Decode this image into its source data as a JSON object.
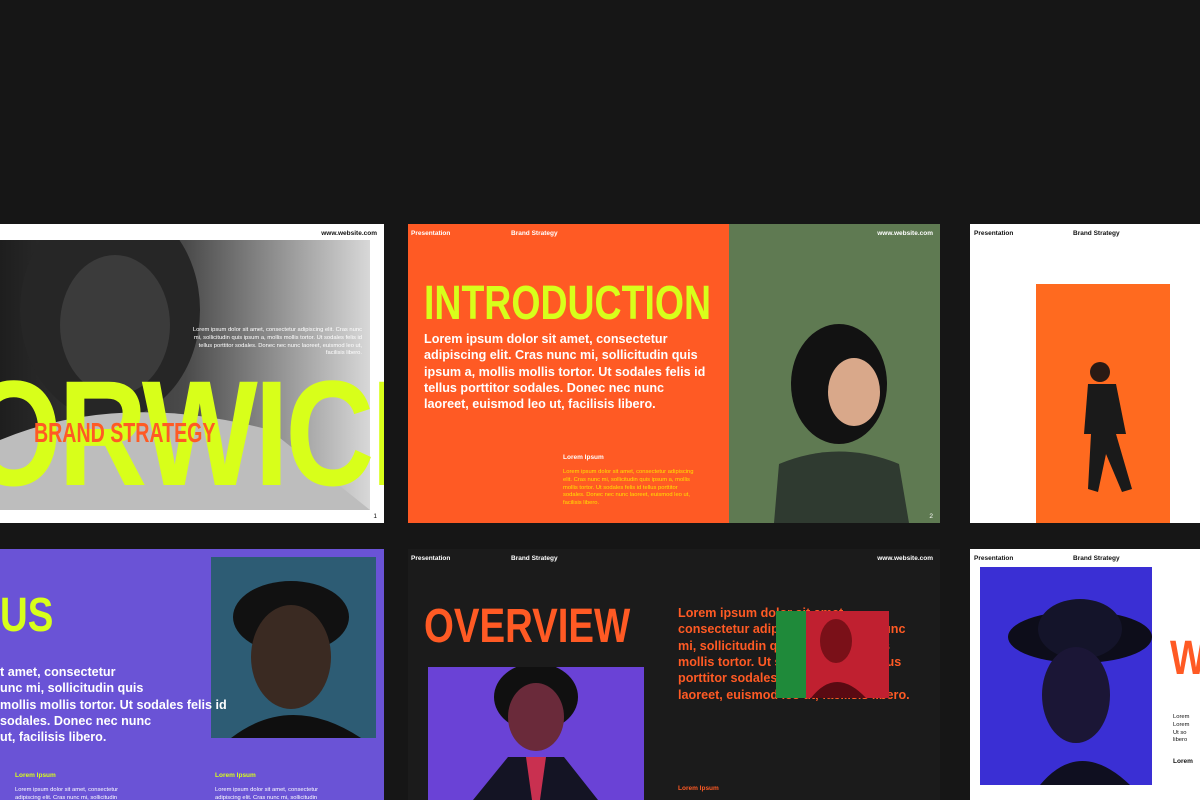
{
  "common": {
    "website": "www.website.com",
    "presentation": "Presentation",
    "brand_strategy": "Brand Strategy",
    "lorem_ipsum": "Lorem Ipsum",
    "small_text": "Lorem ipsum dolor sit amet, consectetur adipiscing elit. Cras nunc mi, sollicitudin quis ipsum a, mollis mollis tortor. Ut sodales felis id tellus porttitor sodales. Donec nec nunc laoreet, euismod leo ut, facilisis libero.",
    "body_text": "Lorem ipsum dolor sit amet, consectetur adipiscing elit. Cras nunc mi, sollicitudin quis ipsum a, mollis mollis tortor. Ut sodales felis id tellus porttitor sodales. Donec nec nunc laoreet, euismod leo ut, facilisis libero."
  },
  "slide1": {
    "big_title": "ORWICH",
    "subtitle": "BRAND STRATEGY",
    "page": "1",
    "small_text": "Lorem ipsum dolor sit amet, consectetur adipiscing elit. Cras nunc mi, sollicitudin quis ipsum a, mollis mollis tortor. Ut sodales felis id tellus porttitor sodales. Donec nec nunc laoreet, euismod leo ut, facilisis libero."
  },
  "slide2": {
    "title": "INTRODUCTION",
    "page": "2"
  },
  "slide4": {
    "title_partial": "US",
    "body_partial": "t amet, consectetur\nunc mi, sollicitudin quis\nmollis mollis tortor. Ut sodales felis id\nsodales. Donec nec nunc\nut, facilisis libero.",
    "label_a": "Lorem Ipsum",
    "label_b": "Lorem Ipsum",
    "small_a": "Lorem ipsum dolor sit amet, consectetur adipiscing elit. Cras nunc mi, sollicitudin",
    "small_b": "Lorem ipsum dolor sit amet, consectetur adipiscing elit. Cras nunc mi, sollicitudin"
  },
  "slide5": {
    "title": "OVERVIEW",
    "label": "Lorem Ipsum"
  },
  "slide6": {
    "title_partial": "W",
    "small_partial": "Lorem\nLorem\nUt so\nlibero",
    "label_partial": "Lorem"
  },
  "colors": {
    "background": "#161616",
    "lime": "#d8ff1a",
    "orange": "#ff5a24",
    "green": "#5f7a52",
    "purple": "#6a53d6",
    "dark_slide": "#1b1b1b"
  }
}
